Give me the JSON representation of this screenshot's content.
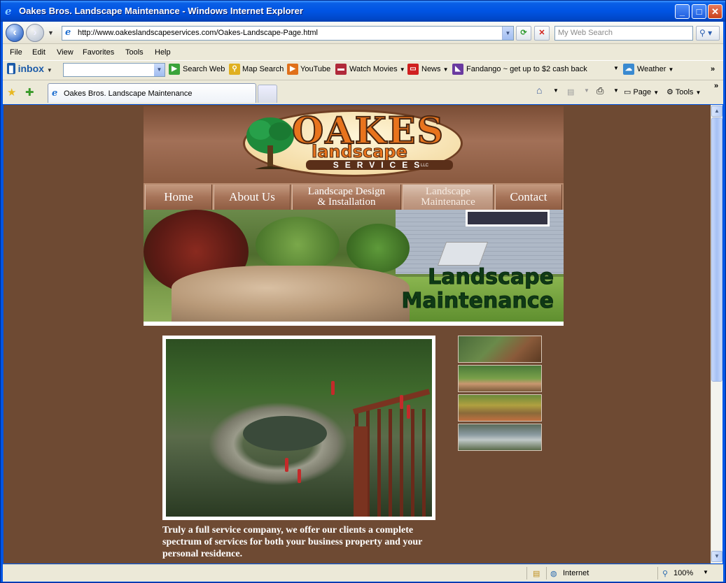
{
  "window": {
    "title": "Oakes Bros. Landscape Maintenance - Windows Internet Explorer",
    "minimize": "_",
    "maximize": "□",
    "close": "✕"
  },
  "address_bar": {
    "url": "http://www.oakeslandscapeservices.com/Oakes-Landscape-Page.html",
    "search_placeholder": "My Web Search"
  },
  "menu": {
    "items": [
      "File",
      "Edit",
      "View",
      "Favorites",
      "Tools",
      "Help"
    ]
  },
  "toolbar": {
    "inbox_label": "inbox",
    "search_web": "Search Web",
    "map_search": "Map Search",
    "youtube": "YouTube",
    "watch_movies": "Watch Movies",
    "news": "News",
    "fandango": "Fandango ~ get up to $2 cash back",
    "weather": "Weather",
    "overflow": "»"
  },
  "tabs": {
    "active_label": "Oakes Bros. Landscape Maintenance",
    "page_menu": "Page",
    "tools_menu": "Tools"
  },
  "site": {
    "logo": {
      "oakes": "OAKES",
      "landscape": "landscape",
      "services": "SERVICES",
      "llc": "LLC"
    },
    "nav": [
      {
        "label": "Home"
      },
      {
        "label": "About Us"
      },
      {
        "line1": "Landscape Design",
        "line2": "& Installation"
      },
      {
        "line1": "Landscape",
        "line2": "Maintenance"
      },
      {
        "label": "Contact"
      }
    ],
    "banner_title_line1": "Landscape",
    "banner_title_line2": "Maintenance",
    "body_text": "Truly a full service company, we offer our clients a complete spectrum of services for both your business property and your personal residence."
  },
  "status": {
    "zone": "Internet",
    "zoom": "100%"
  },
  "colors": {
    "page_bg": "#6e4a33",
    "accent_orange": "#e8741d",
    "banner_text": "#0f3a16"
  }
}
